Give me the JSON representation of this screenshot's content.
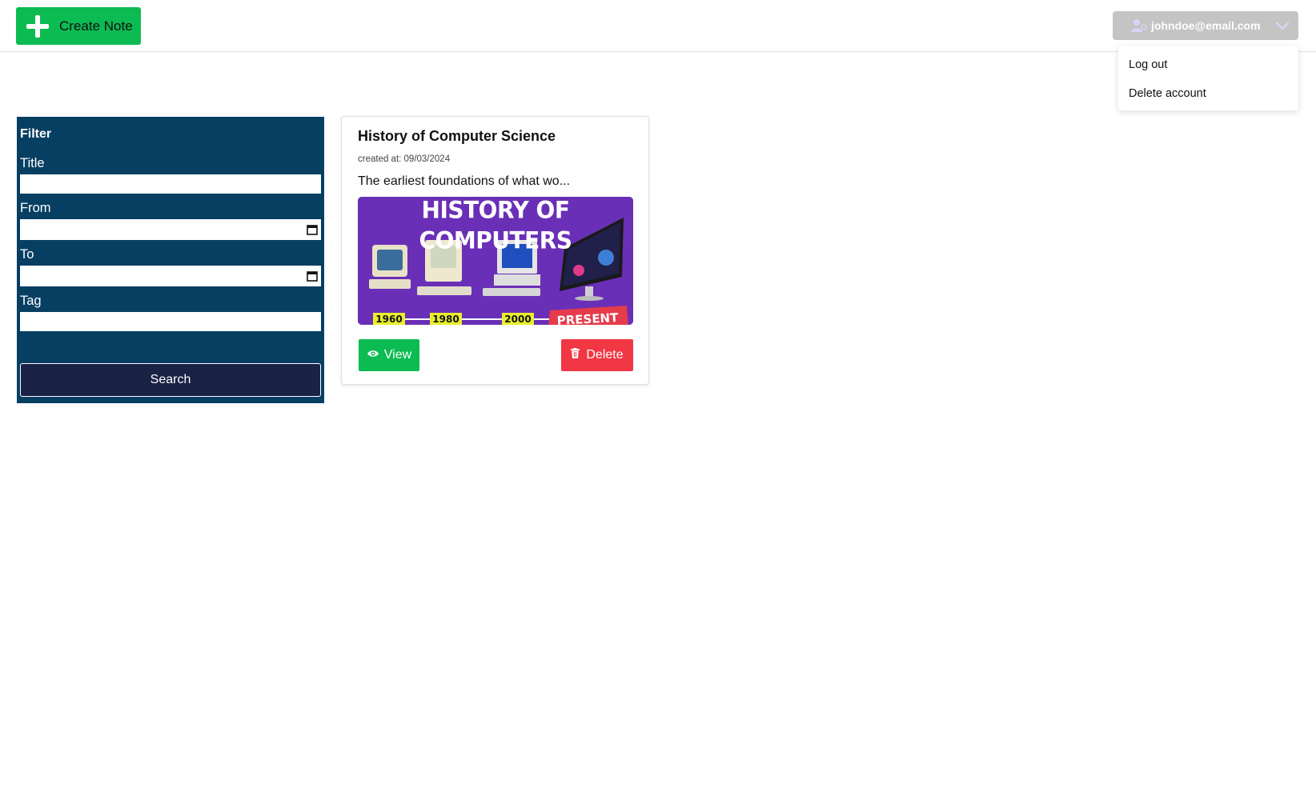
{
  "topbar": {
    "create_note_label": "Create Note",
    "user_email": "johndoe@email.com"
  },
  "user_dropdown": {
    "items": [
      {
        "label": "Log out"
      },
      {
        "label": "Delete account"
      }
    ]
  },
  "filter": {
    "heading": "Filter",
    "fields": {
      "title_label": "Title",
      "from_label": "From",
      "to_label": "To",
      "tag_label": "Tag"
    },
    "values": {
      "title": "",
      "from": "",
      "to": "",
      "tag": ""
    },
    "search_label": "Search"
  },
  "notes": [
    {
      "title": "History of Computer Science",
      "created_at": "created at: 09/03/2024",
      "excerpt": "The earliest foundations of what wo...",
      "thumbnail": {
        "heading": "HISTORY OF COMPUTERS",
        "years": [
          "1960",
          "1980",
          "2000"
        ],
        "present_label": "PRESENT"
      },
      "view_label": "View",
      "delete_label": "Delete"
    }
  ],
  "colors": {
    "green": "#0cbb52",
    "red": "#f03743",
    "filter_bg": "#073f63",
    "search_bg": "#1a2246",
    "user_menu_bg": "#c4c4c4",
    "thumb_bg": "#6a2fb7",
    "year_tag": "#e8ef2a"
  },
  "icons": {
    "create": "plus-icon",
    "user": "user-icon",
    "dropdown": "chevron-down-icon",
    "calendar": "calendar-icon",
    "view": "eye-icon",
    "delete": "trash-icon"
  }
}
